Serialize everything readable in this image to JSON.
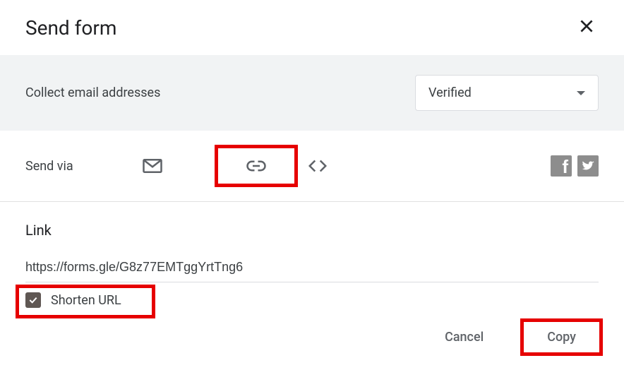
{
  "dialog": {
    "title": "Send form"
  },
  "collect": {
    "label": "Collect email addresses",
    "selected": "Verified"
  },
  "sendVia": {
    "label": "Send via"
  },
  "link": {
    "section_title": "Link",
    "url": "https://forms.gle/G8z77EMTggYrtTng6",
    "shorten_label": "Shorten URL"
  },
  "actions": {
    "cancel": "Cancel",
    "copy": "Copy"
  }
}
